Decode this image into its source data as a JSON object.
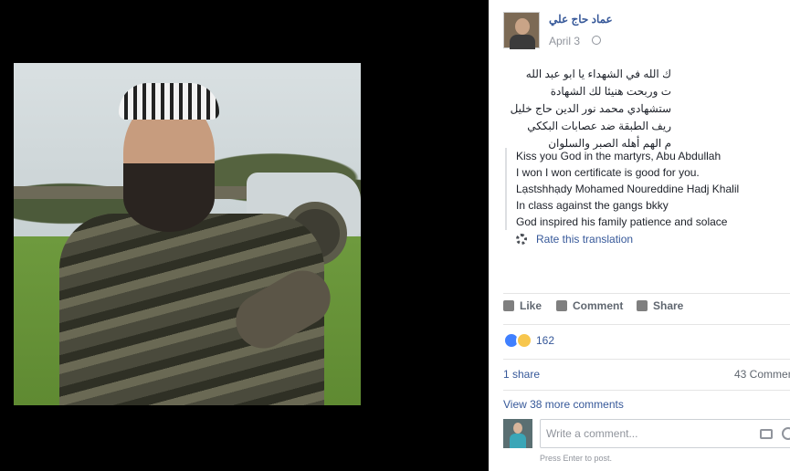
{
  "post": {
    "author": "عماد حاج علي",
    "date": "April 3",
    "arabic_lines": [
      "ك الله في الشهداء يا ابو عبد الله",
      "ت وربحت هنيئا لك الشهادة",
      "ستشهادي محمد نور الدين حاج خليل",
      "ريف الطبقة ضد عصابات البككي",
      "م الهم أهله الصبر والسلوان"
    ],
    "translation_lines": [
      "Kiss you God in the martyrs, Abu Abdullah",
      "I won I won certificate is good for you.",
      "Lạstshhạdy Mohamed Noureddine Hadj Khalil",
      "In class against the gangs bkky",
      "God inspired his family patience and solace"
    ],
    "rate_translation": "Rate this translation"
  },
  "actions": {
    "like": "Like",
    "comment": "Comment",
    "share": "Share"
  },
  "stats": {
    "reactions_count": "162",
    "shares": "1 share",
    "comments": "43 Commen",
    "view_more": "View 38 more comments"
  },
  "composer": {
    "placeholder": "Write a comment...",
    "hint": "Press Enter to post."
  },
  "icons": {
    "globe": "globe-icon",
    "gear": "gear-icon",
    "camera": "camera-icon",
    "emoji": "emoji-icon"
  }
}
